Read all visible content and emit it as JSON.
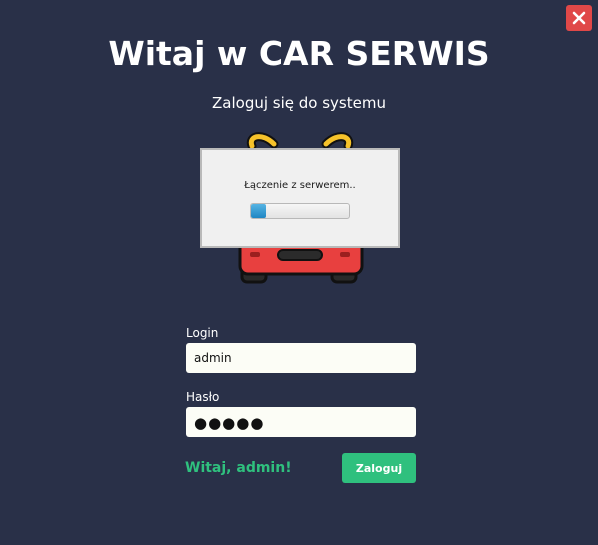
{
  "app": {
    "title": "Witaj w CAR SERWIS",
    "subtitle": "Zaloguj się do systemu"
  },
  "window": {
    "close_icon": "close-icon"
  },
  "dialog": {
    "message": "Łączenie z serwerem..",
    "progress_fraction": 0.15
  },
  "form": {
    "login_label": "Login",
    "login_value": "admin",
    "password_label": "Hasło",
    "password_masked": "●●●●●",
    "welcome_text": "Witaj, admin!",
    "submit_label": "Zaloguj"
  },
  "colors": {
    "background": "#293048",
    "accent_green": "#2fc07e",
    "close_red": "#e04848",
    "field_bg": "#fcfdf6",
    "car_red": "#e8403f",
    "car_yellow": "#f6c22a"
  }
}
